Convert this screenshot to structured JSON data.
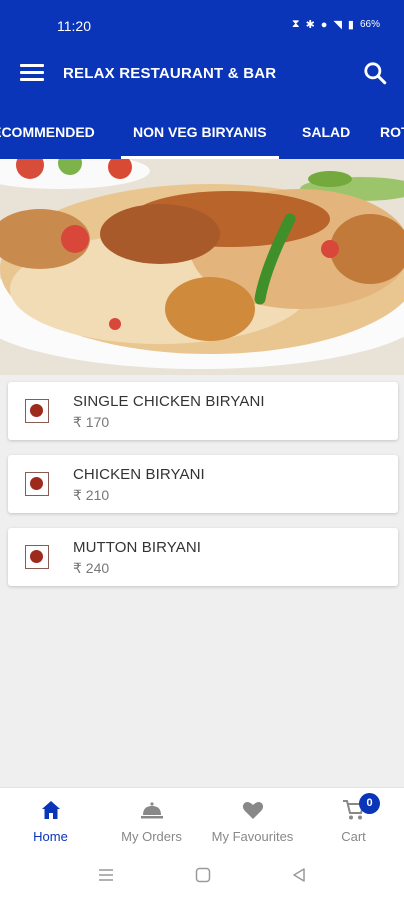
{
  "status_bar": {
    "time": "11:20",
    "battery": "66%",
    "icons": [
      "signal-icon",
      "bluetooth-icon",
      "location-icon",
      "wifi-icon",
      "cell-signal-icon",
      "battery-icon"
    ]
  },
  "app_bar": {
    "title": "RELAX RESTAURANT & BAR",
    "menu_icon": "menu-icon",
    "search_icon": "search-icon"
  },
  "tabs": [
    {
      "label": "RECOMMENDED",
      "active": false
    },
    {
      "label": "NON VEG BIRYANIS",
      "active": true
    },
    {
      "label": "SALAD",
      "active": false
    },
    {
      "label": "ROTI",
      "active": false
    }
  ],
  "menu_items": [
    {
      "name": "SINGLE CHICKEN BIRYANI",
      "price": "₹ 170",
      "type": "non-veg"
    },
    {
      "name": "CHICKEN BIRYANI",
      "price": "₹ 210",
      "type": "non-veg"
    },
    {
      "name": "MUTTON BIRYANI",
      "price": "₹ 240",
      "type": "non-veg"
    }
  ],
  "bottom_nav": [
    {
      "label": "Home",
      "icon": "home-icon",
      "active": true
    },
    {
      "label": "My Orders",
      "icon": "cloche-icon",
      "active": false
    },
    {
      "label": "My Favourites",
      "icon": "heart-icon",
      "active": false
    },
    {
      "label": "Cart",
      "icon": "cart-icon",
      "active": false,
      "badge": "0"
    }
  ],
  "colors": {
    "primary": "#0a35b8",
    "background": "#efefef",
    "nonveg_dot": "#9e2a1c"
  }
}
